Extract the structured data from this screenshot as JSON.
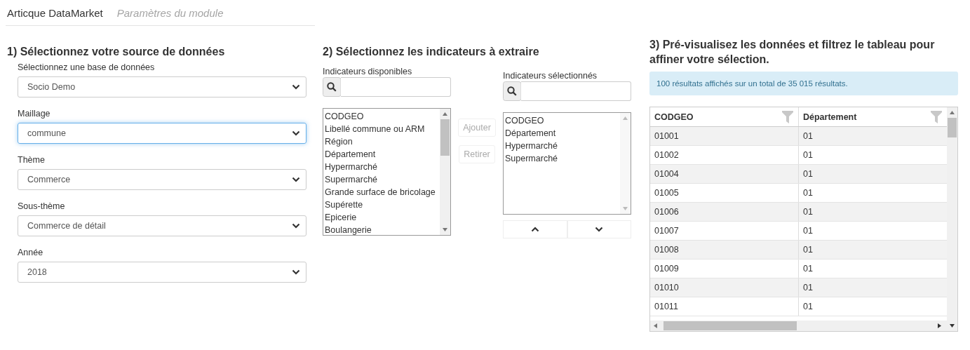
{
  "header": {
    "title": "Articque DataMarket",
    "subtitle": "Paramètres du module"
  },
  "source": {
    "heading": "1) Sélectionnez votre source de données",
    "fields": [
      {
        "label": "Sélectionnez une base de données",
        "value": "Socio Demo",
        "focused": false
      },
      {
        "label": "Maillage",
        "value": "commune",
        "focused": true
      },
      {
        "label": "Thème",
        "value": "Commerce",
        "focused": false
      },
      {
        "label": "Sous-thème",
        "value": "Commerce de détail",
        "focused": false
      },
      {
        "label": "Année",
        "value": "2018",
        "focused": false
      }
    ]
  },
  "indicators": {
    "heading": "2) Sélectionnez les indicateurs à extraire",
    "available": {
      "label": "Indicateurs disponibles",
      "items": [
        "CODGEO",
        "Libellé commune ou ARM",
        "Région",
        "Département",
        "Hypermarché",
        "Supermarché",
        "Grande surface de bricolage",
        "Supérette",
        "Epicerie",
        "Boulangerie"
      ]
    },
    "buttons": [
      {
        "label": "Ajouter",
        "disabled": true
      },
      {
        "label": "Retirer",
        "disabled": true
      }
    ],
    "selected": {
      "label": "Indicateurs sélectionnés",
      "items": [
        "CODGEO",
        "Département",
        "Hypermarché",
        "Supermarché"
      ]
    }
  },
  "preview": {
    "heading": "3) Pré-visualisez les données et filtrez le tableau pour affiner votre sélection.",
    "info": "100 résultats affichés sur un total de 35 015 résultats.",
    "table": {
      "columns": [
        "CODGEO",
        "Département"
      ],
      "rows": [
        [
          "01001",
          "01"
        ],
        [
          "01002",
          "01"
        ],
        [
          "01004",
          "01"
        ],
        [
          "01005",
          "01"
        ],
        [
          "01006",
          "01"
        ],
        [
          "01007",
          "01"
        ],
        [
          "01008",
          "01"
        ],
        [
          "01009",
          "01"
        ],
        [
          "01010",
          "01"
        ],
        [
          "01011",
          "01"
        ]
      ]
    }
  }
}
